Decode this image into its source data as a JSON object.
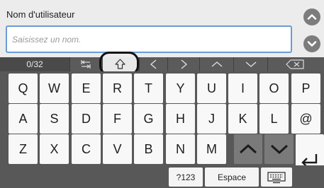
{
  "header": {
    "field_label": "Nom d'utilisateur",
    "input_placeholder": "Saisissez un nom.",
    "input_value": ""
  },
  "toolbar": {
    "char_count": "0/32"
  },
  "keyboard": {
    "row1": [
      "Q",
      "W",
      "E",
      "R",
      "T",
      "Y",
      "U",
      "I",
      "O",
      "P"
    ],
    "row2": [
      "A",
      "S",
      "D",
      "F",
      "G",
      "H",
      "J",
      "K",
      "L",
      "@"
    ],
    "row3": [
      "Z",
      "X",
      "C",
      "V",
      "B",
      "N",
      "M"
    ],
    "numbers_key": "?123",
    "space_key": "Espace"
  },
  "icons": {
    "scroll_up": "chevron-up-circle-icon",
    "scroll_down": "chevron-down-circle-icon",
    "tab": "tab-arrows-icon",
    "shift": "shift-arrow-icon",
    "cursor_left": "chevron-left-icon",
    "cursor_right": "chevron-right-icon",
    "page_up": "chevron-up-icon",
    "page_down": "chevron-down-icon",
    "backspace": "backspace-icon",
    "enter": "enter-icon",
    "hide_keyboard": "keyboard-icon"
  },
  "colors": {
    "input_border": "#6a9bd6",
    "toolbar_bg": "#4f4f4f",
    "key_bg": "#f8f8f8",
    "keyboard_bg": "#585858",
    "highlight": "#111111"
  }
}
